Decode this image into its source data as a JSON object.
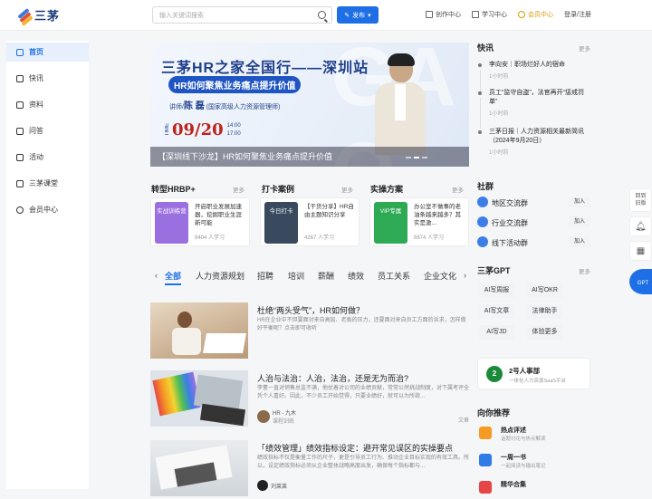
{
  "topbar": {
    "logo_text": "三茅",
    "search_placeholder": "输入关键词搜索",
    "publish_label": "发布",
    "nav": [
      "创作中心",
      "学习中心",
      "会员中心",
      "登录/注册"
    ]
  },
  "sidebar": {
    "items": [
      {
        "label": "首页",
        "icon": "home-icon",
        "active": true
      },
      {
        "label": "快讯",
        "icon": "flash-icon",
        "active": false
      },
      {
        "label": "资料",
        "icon": "folder-icon",
        "active": false
      },
      {
        "label": "问答",
        "icon": "qa-icon",
        "active": false
      },
      {
        "label": "活动",
        "icon": "flag-icon",
        "active": false
      },
      {
        "label": "三茅课堂",
        "icon": "play-icon",
        "active": false
      },
      {
        "label": "会员中心",
        "icon": "vip-icon",
        "active": false
      }
    ]
  },
  "banner": {
    "title": "三茅HR之家全国行——深圳站",
    "subtitle": "HR如何聚焦业务痛点提升价值",
    "lecturer_prefix": "讲师/",
    "lecturer_name": "陈 磊",
    "lecturer_title": "(国家高级人力资源管理师)",
    "time_label": "TIME",
    "date": "09/20",
    "hours_start": "14:00",
    "hours_end": "17:00",
    "bg_letters": "GA O",
    "caption": "【深圳线下沙龙】HR如何聚焦业务痛点提升价值"
  },
  "sections": {
    "hrbp": {
      "title": "转型HRBP+",
      "more": "更多"
    },
    "case": {
      "title": "打卡案例",
      "more": "更多"
    },
    "plan": {
      "title": "实操方案",
      "more": "更多"
    }
  },
  "cards": [
    {
      "thumb": "实战训练营",
      "title": "开启职业发展加速器，挖掘职业生涯新可能",
      "meta": "8404 人学习",
      "color": "#9a6fe0"
    },
    {
      "thumb": "今日打卡",
      "title": "【干货分享】HR自由主题知识分享",
      "meta": "4267 人学习",
      "color": "#394a5e"
    },
    {
      "thumb": "VIP专属",
      "title": "办公室不做事的老油条越来越多？其实是激...",
      "meta": "6874 人学习",
      "color": "#2eaa55"
    }
  ],
  "tabs": [
    "全部",
    "人力资源规划",
    "招聘",
    "培训",
    "薪酬",
    "绩效",
    "员工关系",
    "企业文化"
  ],
  "feed": [
    {
      "title": "杜绝“两头受气”，HR如何做？",
      "desc": "HR在企业中不但要面对来自高层、老板的压力，还要面对来自员工方面的诉求，怎样做好平衡呢？点击即可收听",
      "author": "",
      "author_sub": "",
      "type": ""
    },
    {
      "title": "人治与法治：人治，法治，还是无为而治?",
      "desc": "李董一直对销售总监不满，他仗着对公司的业绩贡献，常常公然挑战制度，对下属考评全凭个人喜好。因此，不少员工开始觉得，只要业绩好，就可以为所欲...",
      "author": "HR - 九木",
      "author_sub": "课程训练",
      "type": "文章"
    },
    {
      "title": "「绩效管理」绩效指标设定：避开常见误区的实操要点",
      "desc": "绩效指标不仅是衡量工作的尺子，更是引导员工行为、推动企业目标实现的有效工具。所以，设定绩效指标必须从企业整体战略高度出发，确保每个指标都与...",
      "author": "刘莱莱",
      "author_sub": "",
      "type": ""
    }
  ],
  "right": {
    "flash": {
      "title": "快讯",
      "more": "更多",
      "items": [
        {
          "text": "李向安｜职场烂好人的宿命",
          "time": "1小时前"
        },
        {
          "text": "员工“监守自盗”，法官再开“惩戒罚单”",
          "time": "1小时前"
        },
        {
          "text": "三茅日报｜人力资源相关最新简讯（2024年9月20日）",
          "time": "1小时前"
        }
      ]
    },
    "community": {
      "title": "社群",
      "items": [
        {
          "name": "地区交流群",
          "join": "加入"
        },
        {
          "name": "行业交流群",
          "join": "加入"
        },
        {
          "name": "线下活动群",
          "join": "加入"
        }
      ]
    },
    "gpt": {
      "title": "三茅GPT",
      "more": "更多",
      "buttons": [
        "AI写周报",
        "AI写OKR",
        "AI写文章",
        "法律助手",
        "AI写JD",
        "体验更多"
      ]
    },
    "promo": {
      "logo": "2",
      "title": "2号人事部",
      "sub": "一体化人力资源SaaS平台"
    },
    "recommend": {
      "title": "向你推荐",
      "items": [
        {
          "title": "热点评述",
          "sub": "话题讨论与热点解读",
          "color": "#f59a23"
        },
        {
          "title": "一周一书",
          "sub": "一起阅读与输出笔记",
          "color": "#2f7be8"
        },
        {
          "title": "精华合集",
          "sub": "",
          "color": "#e84545"
        }
      ]
    }
  },
  "floatbar": {
    "back": "回到旧版",
    "gpt": "GPT"
  },
  "colors": {
    "accent": "#1e6fe6",
    "vip": "#d89a00",
    "banner_title": "#1e3e8c",
    "date_red": "#c0221a"
  }
}
